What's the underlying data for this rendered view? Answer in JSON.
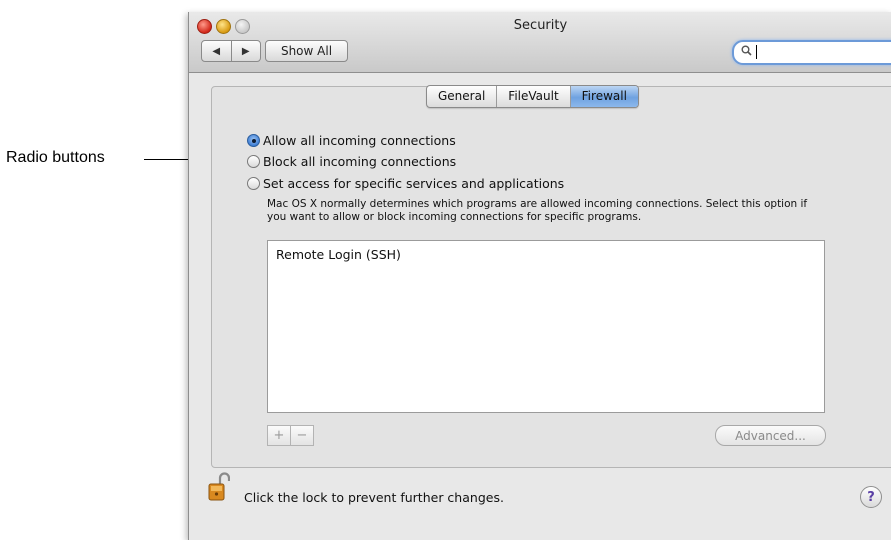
{
  "annotation": {
    "label": "Radio buttons"
  },
  "window": {
    "title": "Security",
    "toolbar": {
      "back_glyph": "◀",
      "forward_glyph": "▶",
      "show_all_label": "Show All",
      "search_value": "",
      "search_icon": "magnifier-icon"
    }
  },
  "tabs": [
    {
      "label": "General",
      "selected": false
    },
    {
      "label": "FileVault",
      "selected": false
    },
    {
      "label": "Firewall",
      "selected": true
    }
  ],
  "firewall": {
    "options": [
      {
        "label": "Allow all incoming connections",
        "checked": true
      },
      {
        "label": "Block all incoming connections",
        "checked": false
      },
      {
        "label": "Set access for specific services and applications",
        "checked": false
      }
    ],
    "description": "Mac OS X normally determines which programs are allowed incoming connections. Select this option if you want to allow or block incoming connections for specific programs.",
    "list_items": [
      "Remote Login (SSH)"
    ],
    "add_label": "+",
    "remove_label": "−",
    "advanced_label": "Advanced..."
  },
  "footer": {
    "lock_text": "Click the lock to prevent further changes.",
    "lock_icon": "open-lock-icon",
    "help_label": "?"
  },
  "colors": {
    "selected_tab": "#6fa2e0",
    "radio_checked": "#3a7bd4",
    "search_focus": "#6c9ad8"
  }
}
